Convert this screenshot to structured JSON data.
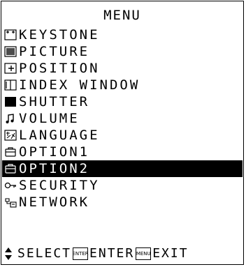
{
  "menu": {
    "title": "MENU",
    "items": [
      {
        "label": "KEYSTONE",
        "icon": "keystone-icon"
      },
      {
        "label": "PICTURE",
        "icon": "picture-icon"
      },
      {
        "label": "POSITION",
        "icon": "position-icon"
      },
      {
        "label": "INDEX WINDOW",
        "icon": "index-window-icon"
      },
      {
        "label": "SHUTTER",
        "icon": "shutter-icon"
      },
      {
        "label": "VOLUME",
        "icon": "volume-icon"
      },
      {
        "label": "LANGUAGE",
        "icon": "language-icon"
      },
      {
        "label": "OPTION1",
        "icon": "option-icon"
      },
      {
        "label": "OPTION2",
        "icon": "option-icon",
        "selected": true
      },
      {
        "label": "SECURITY",
        "icon": "security-icon"
      },
      {
        "label": "NETWORK",
        "icon": "network-icon"
      }
    ]
  },
  "footer": {
    "select_label": "SELECT",
    "enter_key": "ENTER",
    "enter_label": "ENTER",
    "menu_key": "MENU",
    "exit_label": "EXIT"
  },
  "colors": {
    "background": "#ffffff",
    "foreground": "#000000",
    "highlight": "#000000",
    "highlight_text": "#ffffff"
  }
}
